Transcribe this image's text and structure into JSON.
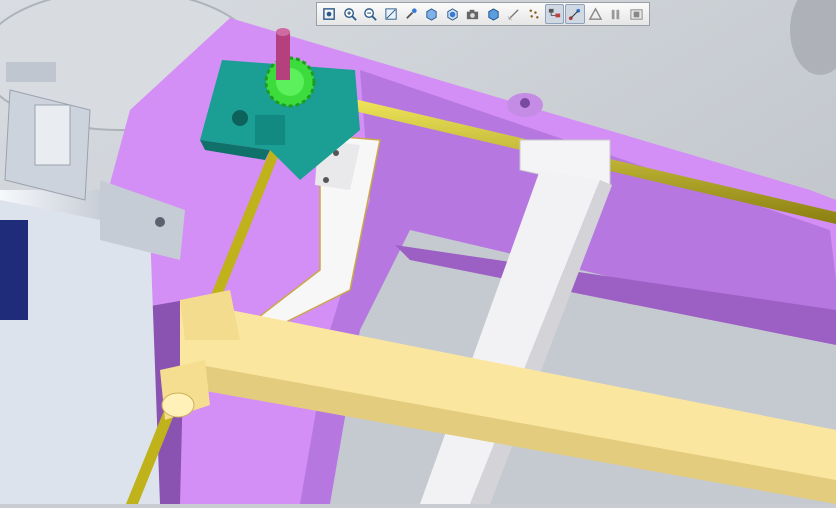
{
  "window": {
    "title": ""
  },
  "toolbar": {
    "buttons": [
      {
        "name": "zoom-fit-icon",
        "active": false
      },
      {
        "name": "zoom-in-icon",
        "active": false
      },
      {
        "name": "zoom-out-icon",
        "active": false
      },
      {
        "name": "zoom-area-icon",
        "active": false
      },
      {
        "name": "rotate-icon",
        "active": false
      },
      {
        "name": "view-orientation-icon",
        "active": false
      },
      {
        "name": "display-style-icon",
        "active": false
      },
      {
        "name": "camera-icon",
        "active": false
      },
      {
        "name": "cube-view-icon",
        "active": false
      },
      {
        "name": "section-view-icon",
        "active": false
      },
      {
        "name": "point-cloud-icon",
        "active": false
      },
      {
        "name": "assembly-tree-icon",
        "active": true
      },
      {
        "name": "mate-connect-icon",
        "active": true
      },
      {
        "name": "triangle-measure-icon",
        "active": false
      },
      {
        "name": "pause-icon",
        "active": false
      },
      {
        "name": "stop-record-icon",
        "active": false
      }
    ]
  },
  "scene": {
    "colors": {
      "background": "#c9cdd2",
      "tray": "#d38ff5",
      "tray_shadow": "#9c5fc4",
      "gear": "#3ddc3d",
      "bracket": "#1b9f95",
      "rod": "#c9bb1e",
      "arm": "#f4f4f6",
      "frame": "#fbe6a0",
      "motor": "#e6ebf2",
      "shaft": "#b4417e"
    }
  }
}
